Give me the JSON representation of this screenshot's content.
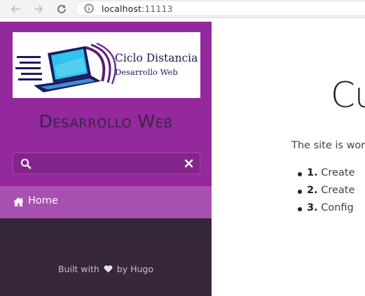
{
  "browser": {
    "url_host": "localhost",
    "url_port": ":11113",
    "back_icon": "arrow-left-icon",
    "forward_icon": "arrow-right-icon",
    "reload_icon": "reload-icon",
    "info_icon": "info-icon"
  },
  "sidebar": {
    "logo": {
      "line1": "Ciclo Distancia",
      "line2": "Desarrollo Web",
      "icon": "laptop-logo"
    },
    "site_title": "Desarrollo Web",
    "search": {
      "placeholder": "",
      "value": "",
      "icon": "search-icon",
      "clear_icon": "close-icon"
    },
    "menu": [
      {
        "label": "Home",
        "icon": "home-icon",
        "active": true
      }
    ],
    "footer": {
      "prefix": "Built with",
      "suffix": "by Hugo",
      "icon": "heart-icon"
    },
    "colors": {
      "sidebar_bg": "#93299c",
      "menu_active_bg": "#a84fb2",
      "footer_bg": "#36273a",
      "title_color": "#3d2147"
    }
  },
  "main": {
    "title": "Cu",
    "intro": "The site is wor",
    "steps": [
      {
        "num": "1.",
        "text": "Create"
      },
      {
        "num": "2.",
        "text": "Create"
      },
      {
        "num": "3.",
        "text": "Config"
      }
    ]
  }
}
